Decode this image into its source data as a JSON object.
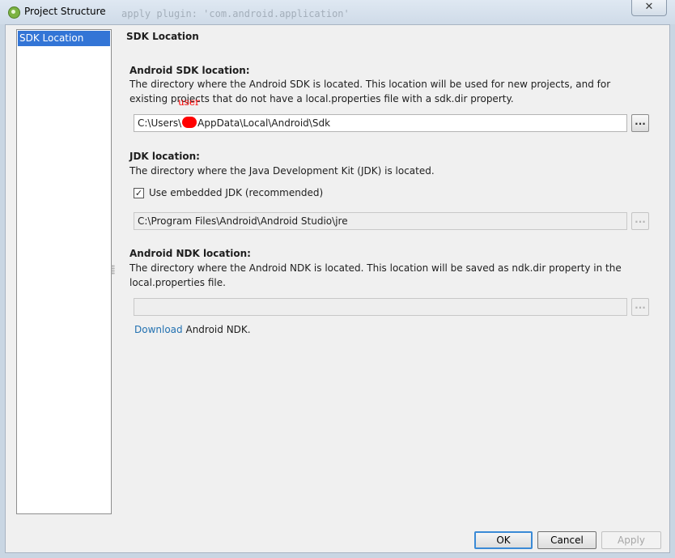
{
  "window": {
    "title": "Project Structure",
    "background_code": "apply plugin: 'com.android.application'",
    "close_glyph": "✕"
  },
  "sidebar": {
    "items": [
      {
        "label": "SDK Location",
        "selected": true
      }
    ]
  },
  "content": {
    "page_title": "SDK Location",
    "sdk": {
      "title": "Android SDK location:",
      "description": "The directory where the Android SDK is located. This location will be used for new projects, and for existing projects that do not have a local.properties file with a sdk.dir property.",
      "path_prefix": "C:\\Users\\",
      "redaction_label": "user",
      "path_suffix": "AppData\\Local\\Android\\Sdk",
      "browse_label": "..."
    },
    "jdk": {
      "title": "JDK location:",
      "description": "The directory where the Java Development Kit (JDK) is located.",
      "checkbox_label": "Use embedded JDK (recommended)",
      "checkbox_checked": true,
      "check_glyph": "✓",
      "path": "C:\\Program Files\\Android\\Android Studio\\jre",
      "browse_label": "..."
    },
    "ndk": {
      "title": "Android NDK location:",
      "description": "The directory where the Android NDK is located. This location will be saved as ndk.dir property in the local.properties file.",
      "path": "",
      "browse_label": "...",
      "download_link": "Download",
      "download_suffix": "Android NDK."
    }
  },
  "buttons": {
    "ok": "OK",
    "cancel": "Cancel",
    "apply": "Apply"
  },
  "colors": {
    "selection": "#3375d6",
    "link": "#2271b1",
    "redaction": "#ff0000"
  }
}
